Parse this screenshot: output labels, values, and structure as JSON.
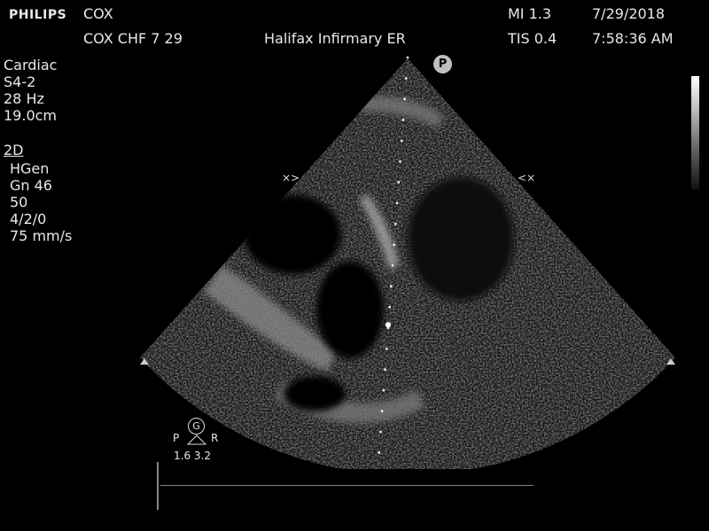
{
  "header": {
    "brand": "PHILIPS",
    "patient_name": "COX",
    "study_label": "COX CHF 7 29",
    "institution": "Halifax Infirmary ER",
    "mi": "MI 1.3",
    "tis": "TIS 0.4",
    "date": "7/29/2018",
    "time": "7:58:36 AM"
  },
  "settings": {
    "preset": "Cardiac",
    "probe": "S4-2",
    "frame_rate": "28 Hz",
    "depth": "19.0cm",
    "mode": "2D",
    "params": [
      "HGen",
      "Gn 46",
      "50",
      "4/2/0",
      "75 mm/s"
    ]
  },
  "image": {
    "orientation_marker": "P",
    "focus_badge": "G",
    "focus_left_label": "P",
    "focus_right_label": "R",
    "focus_values": "1.6 3.2"
  },
  "colors": {
    "timeline": "#2fbf3a",
    "text": "#e8e8e8"
  }
}
